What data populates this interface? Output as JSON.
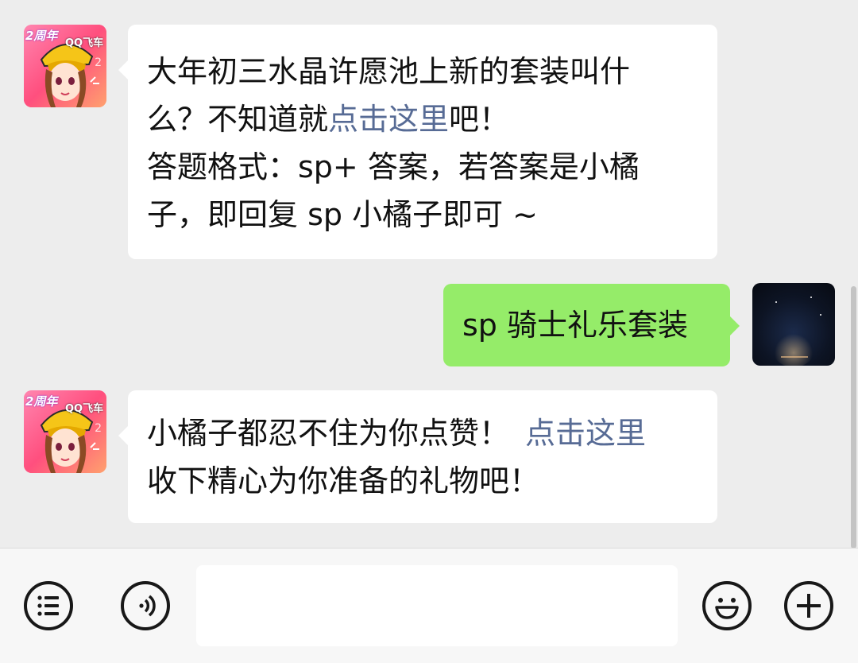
{
  "messages": [
    {
      "sender": "bot",
      "lines": [
        {
          "text": "大年初三水晶许愿池上新的套装叫什"
        },
        {
          "before": "么？不知道就",
          "link": "点击这里",
          "after": "吧！"
        },
        {
          "text": "答题格式：sp+ 答案，若答案是小橘"
        },
        {
          "text": "子，即回复 sp 小橘子即可 ~"
        }
      ]
    },
    {
      "sender": "user",
      "text": "sp 骑士礼乐套装"
    },
    {
      "sender": "bot",
      "line1_text": "小橘子都忍不住为你点赞！",
      "line1_link": "点击这里",
      "line2_text": "收下精心为你准备的礼物吧！"
    }
  ],
  "bot_avatar": {
    "badge": "2周年",
    "logo": "QQ飞车",
    "deco": "2"
  },
  "input_bar": {
    "value": "",
    "placeholder": ""
  },
  "icons": {
    "menu": "menu-list-icon",
    "voice": "voice-icon",
    "emoji": "emoji-icon",
    "plus": "plus-icon"
  },
  "colors": {
    "chat_background": "#ededed",
    "bubble_bot": "#ffffff",
    "bubble_user": "#95ec69",
    "link": "#576b95",
    "bar_background": "#f7f7f7"
  }
}
